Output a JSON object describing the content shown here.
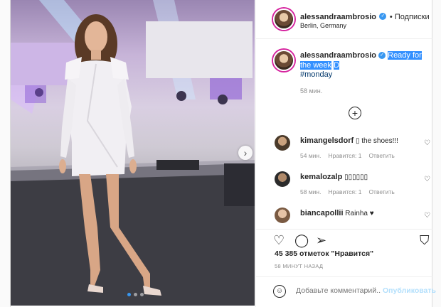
{
  "header": {
    "username": "alessandraambrosio",
    "follow_label": "Подписки",
    "location": "Berlin, Germany"
  },
  "caption": {
    "username": "alessandraambrosio",
    "text": "Ready for the week",
    "text_tail": "D",
    "hashtag": "#monday",
    "time": "58 мин."
  },
  "comments": [
    {
      "username": "kimangelsdorf",
      "text": "▯ the shoes!!!",
      "time": "54 мин.",
      "likes": "Нравится: 1",
      "reply": "Ответить"
    },
    {
      "username": "kemalozalp",
      "text": "▯▯▯▯▯▯",
      "time": "58 мин.",
      "likes": "Нравится: 1",
      "reply": "Ответить"
    },
    {
      "username": "biancapollii",
      "text": "Rainha ♥",
      "time": "",
      "likes": "",
      "reply": ""
    }
  ],
  "likes_label": "45 385 отметок \"Нравится\"",
  "timestamp": "58 МИНУТ НАЗАД",
  "composer": {
    "placeholder": "Добавьте комментарий...",
    "publish": "Опубликовать"
  },
  "carousel": {
    "total": 3,
    "active_index": 0
  },
  "colors": {
    "link": "#00376b",
    "accent": "#3897f0",
    "muted": "#8e8e8e"
  }
}
